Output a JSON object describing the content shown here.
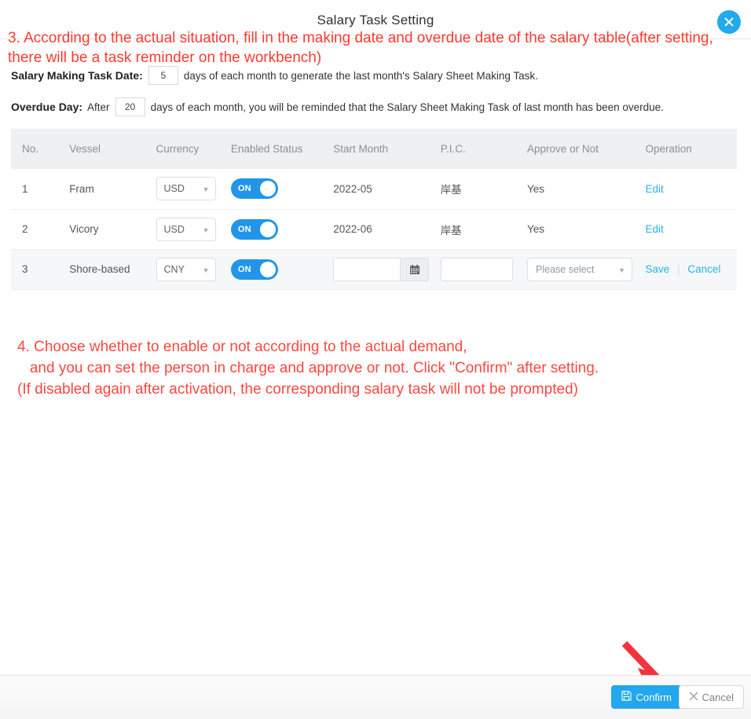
{
  "dialog": {
    "title": "Salary Task Setting",
    "close_icon": "close-icon"
  },
  "annotations": {
    "note3": "3. According to the actual situation, fill in the making date and overdue date of the salary table(after setting,\nthere will be a task reminder on the workbench)",
    "note4": "4. Choose whether to enable or not according to the actual demand,\n   and you can set the person in charge and approve or not. Click \"Confirm\" after setting.\n(If disabled again after activation, the corresponding salary task will not be prompted)",
    "arrow_color": "#f5333f"
  },
  "settings": {
    "making_task": {
      "label": "Salary Making Task Date:",
      "value": "5",
      "suffix": "days of each month to generate the last month's Salary Sheet Making Task."
    },
    "overdue": {
      "label": "Overdue Day:",
      "prefix": "After",
      "value": "20",
      "suffix": "days of each month, you will be reminded that the Salary Sheet Making Task of last month has been overdue."
    }
  },
  "table": {
    "headers": [
      "No.",
      "Vessel",
      "Currency",
      "Enabled Status",
      "Start Month",
      "P.I.C.",
      "Approve or Not",
      "Operation"
    ],
    "rows": [
      {
        "no": "1",
        "vessel": "Fram",
        "currency": "USD",
        "enabled": "ON",
        "start_month": "2022-05",
        "pic": "岸基",
        "approve": "Yes",
        "op_edit": "Edit"
      },
      {
        "no": "2",
        "vessel": "Vicory",
        "currency": "USD",
        "enabled": "ON",
        "start_month": "2022-06",
        "pic": "岸基",
        "approve": "Yes",
        "op_edit": "Edit"
      },
      {
        "no": "3",
        "vessel": "Shore-based",
        "currency": "CNY",
        "enabled": "ON",
        "start_month": "",
        "pic": "",
        "approve": "Please select",
        "op_save": "Save",
        "op_cancel": "Cancel"
      }
    ]
  },
  "footer": {
    "confirm_label": "Confirm",
    "cancel_label": "Cancel",
    "confirm_icon": "save-icon",
    "cancel_icon": "close-x-icon",
    "accent_color": "#23a7ee"
  }
}
